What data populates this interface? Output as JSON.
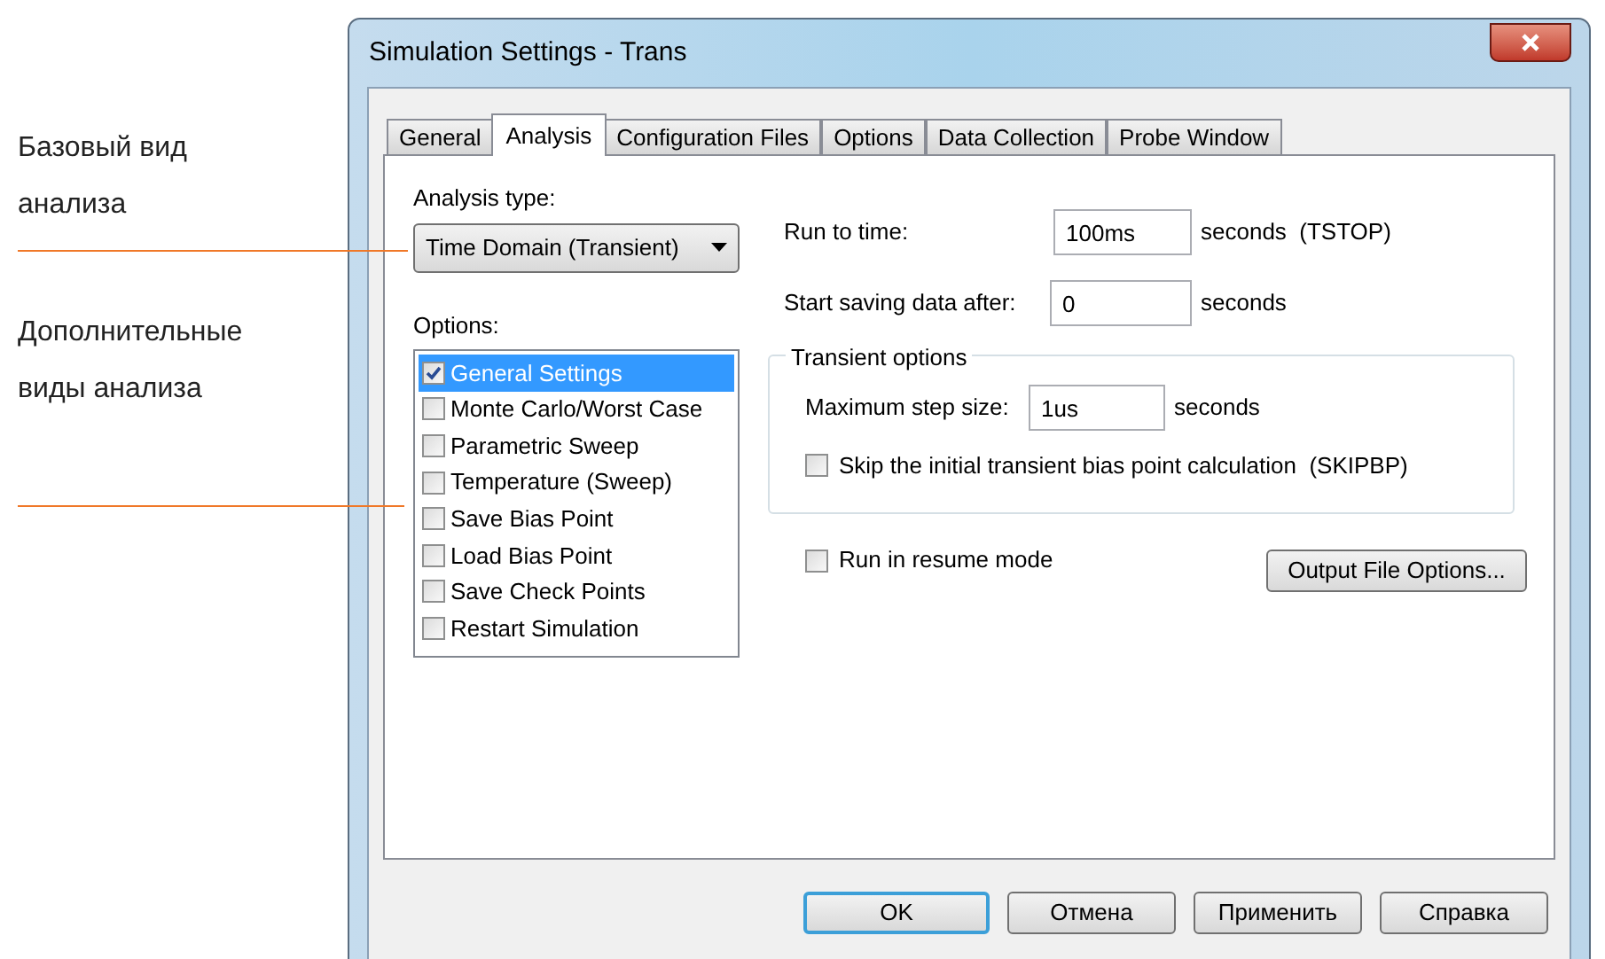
{
  "annotations": [
    {
      "text": "Базовый вид анализа"
    },
    {
      "text": "Дополнительные виды анализа"
    }
  ],
  "window": {
    "title": "Simulation Settings - Trans"
  },
  "tabs": [
    {
      "label": "General",
      "selected": false
    },
    {
      "label": "Analysis",
      "selected": true
    },
    {
      "label": "Configuration Files",
      "selected": false
    },
    {
      "label": "Options",
      "selected": false
    },
    {
      "label": "Data Collection",
      "selected": false
    },
    {
      "label": "Probe Window",
      "selected": false
    }
  ],
  "analysis_type": {
    "label": "Analysis type:",
    "value": "Time Domain (Transient)"
  },
  "options": {
    "label": "Options:",
    "items": [
      {
        "label": "General Settings",
        "checked": true,
        "selected": true
      },
      {
        "label": "Monte Carlo/Worst Case",
        "checked": false,
        "selected": false
      },
      {
        "label": "Parametric Sweep",
        "checked": false,
        "selected": false
      },
      {
        "label": "Temperature (Sweep)",
        "checked": false,
        "selected": false
      },
      {
        "label": "Save Bias Point",
        "checked": false,
        "selected": false
      },
      {
        "label": "Load Bias Point",
        "checked": false,
        "selected": false
      },
      {
        "label": "Save Check Points",
        "checked": false,
        "selected": false
      },
      {
        "label": "Restart Simulation",
        "checked": false,
        "selected": false
      }
    ]
  },
  "run_to_time": {
    "label": "Run to time:",
    "value": "100ms",
    "unit": "seconds  (TSTOP)"
  },
  "start_saving": {
    "label": "Start saving data after:",
    "value": "0",
    "unit": "seconds"
  },
  "transient_options": {
    "title": "Transient options",
    "max_step": {
      "label": "Maximum step size:",
      "value": "1us",
      "unit": "seconds"
    },
    "skip_bias": {
      "label": "Skip the initial transient bias point calculation  (SKIPBP)",
      "checked": false
    }
  },
  "resume_mode": {
    "label": "Run in resume mode",
    "checked": false
  },
  "output_button": "Output File Options...",
  "buttons": [
    {
      "label": "OK",
      "default": true
    },
    {
      "label": "Отмена",
      "default": false
    },
    {
      "label": "Применить",
      "default": false
    },
    {
      "label": "Справка",
      "default": false
    }
  ]
}
